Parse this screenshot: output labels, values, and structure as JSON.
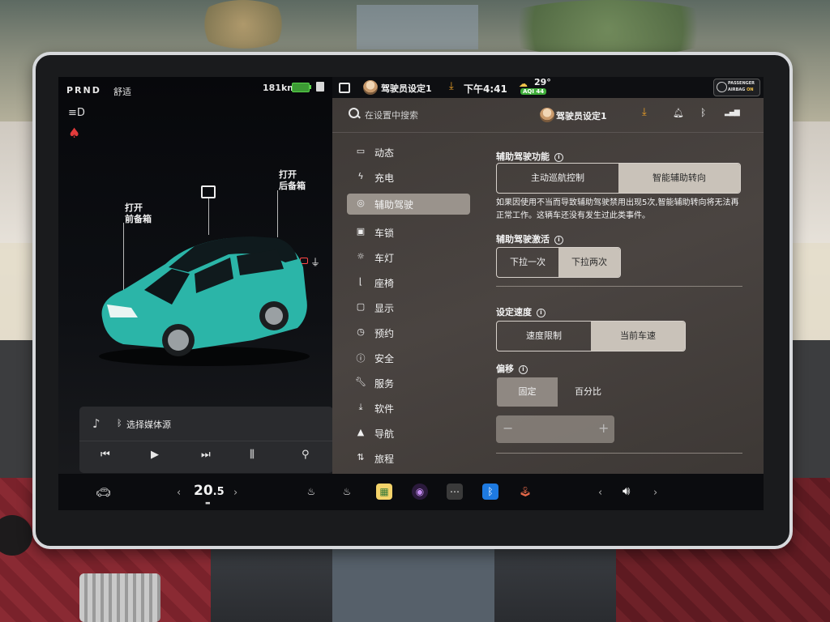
{
  "status": {
    "gear": "PRND",
    "drive_mode": "舒适",
    "range": "181km"
  },
  "car": {
    "frunk": "打开\n前备箱",
    "frunk_line1": "打开",
    "frunk_line2": "前备箱",
    "trunk_line1": "打开",
    "trunk_line2": "后备箱",
    "color": "#2bb5a8"
  },
  "media": {
    "source_label": "选择媒体源"
  },
  "topbar": {
    "profile": "驾驶员设定1",
    "time": "下午4:41",
    "temp": "29°",
    "aqi": "AQI 44",
    "airbag_line1": "PASSENGER",
    "airbag_line2": "AIRBAG",
    "airbag_state": "ON"
  },
  "settings": {
    "search_placeholder": "在设置中搜索",
    "profile": "驾驶员设定1",
    "menu": [
      {
        "label": "动态",
        "icon": "car-icon"
      },
      {
        "label": "充电",
        "icon": "bolt-icon"
      },
      {
        "label": "辅助驾驶",
        "icon": "steering-wheel-icon",
        "active": true
      },
      {
        "label": "车锁",
        "icon": "lock-icon"
      },
      {
        "label": "车灯",
        "icon": "sun-icon"
      },
      {
        "label": "座椅",
        "icon": "seat-icon"
      },
      {
        "label": "显示",
        "icon": "display-icon"
      },
      {
        "label": "预约",
        "icon": "alarm-icon"
      },
      {
        "label": "安全",
        "icon": "safety-icon"
      },
      {
        "label": "服务",
        "icon": "wrench-icon"
      },
      {
        "label": "软件",
        "icon": "download-icon"
      },
      {
        "label": "导航",
        "icon": "navigation-icon"
      },
      {
        "label": "旅程",
        "icon": "trip-icon"
      }
    ],
    "autopilot_title": "辅助驾驶功能",
    "autopilot_options": [
      "主动巡航控制",
      "智能辅助转向"
    ],
    "autopilot_selected": "智能辅助转向",
    "autopilot_note": "如果因使用不当而导致辅助驾驶禁用出现5次,智能辅助转向将无法再正常工作。这辆车还没有发生过此类事件。",
    "activation_title": "辅助驾驶激活",
    "activation_options": [
      "下拉一次",
      "下拉两次"
    ],
    "activation_selected": "下拉两次",
    "speed_title": "设定速度",
    "speed_options": [
      "速度限制",
      "当前车速"
    ],
    "speed_selected": "当前车速",
    "offset_title": "偏移",
    "offset_options": [
      "固定",
      "百分比"
    ],
    "offset_selected": "固定",
    "stepper_minus": "−",
    "stepper_plus": "+"
  },
  "bottom": {
    "temperature_main": "20",
    "temperature_decimal": ".5"
  },
  "colors": {
    "accent_orange": "#f0a226",
    "aqi_green": "#3fae3a",
    "seatbelt_red": "#e23b3b",
    "battery_green": "#58d34a"
  }
}
